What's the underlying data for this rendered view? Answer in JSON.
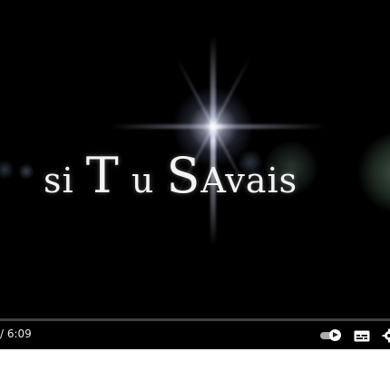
{
  "video": {
    "title_parts": [
      "si",
      "T",
      "u",
      "S",
      "Avais"
    ],
    "time_display": "/ 6:09"
  },
  "controls": {
    "autoplay_icon": "autoplay-toggle-icon",
    "subtitles_icon": "subtitles-icon",
    "settings_icon": "gear-icon"
  },
  "colors": {
    "player_bg": "#000000",
    "text": "#f4f4f4",
    "page_bg": "#ffffff"
  }
}
